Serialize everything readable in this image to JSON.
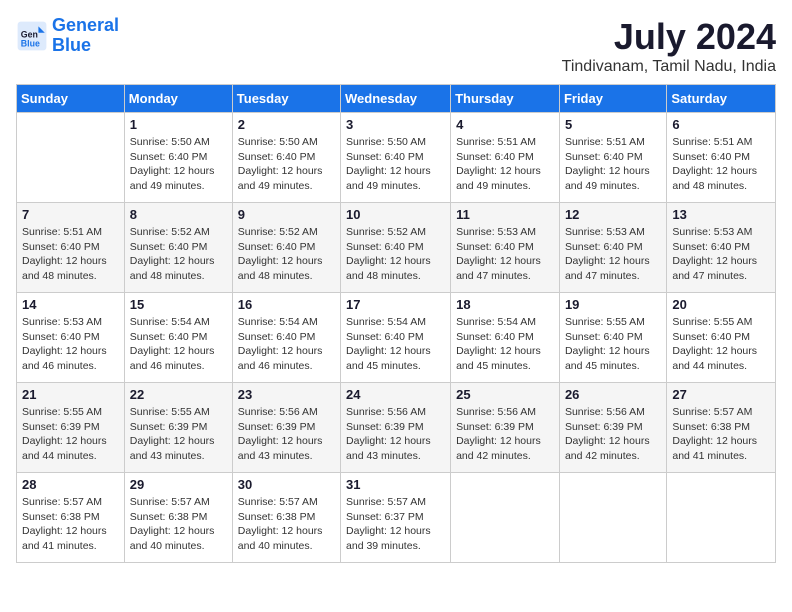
{
  "logo": {
    "line1": "General",
    "line2": "Blue"
  },
  "title": "July 2024",
  "location": "Tindivanam, Tamil Nadu, India",
  "weekdays": [
    "Sunday",
    "Monday",
    "Tuesday",
    "Wednesday",
    "Thursday",
    "Friday",
    "Saturday"
  ],
  "weeks": [
    [
      {
        "day": "",
        "info": ""
      },
      {
        "day": "1",
        "info": "Sunrise: 5:50 AM\nSunset: 6:40 PM\nDaylight: 12 hours\nand 49 minutes."
      },
      {
        "day": "2",
        "info": "Sunrise: 5:50 AM\nSunset: 6:40 PM\nDaylight: 12 hours\nand 49 minutes."
      },
      {
        "day": "3",
        "info": "Sunrise: 5:50 AM\nSunset: 6:40 PM\nDaylight: 12 hours\nand 49 minutes."
      },
      {
        "day": "4",
        "info": "Sunrise: 5:51 AM\nSunset: 6:40 PM\nDaylight: 12 hours\nand 49 minutes."
      },
      {
        "day": "5",
        "info": "Sunrise: 5:51 AM\nSunset: 6:40 PM\nDaylight: 12 hours\nand 49 minutes."
      },
      {
        "day": "6",
        "info": "Sunrise: 5:51 AM\nSunset: 6:40 PM\nDaylight: 12 hours\nand 48 minutes."
      }
    ],
    [
      {
        "day": "7",
        "info": "Sunrise: 5:51 AM\nSunset: 6:40 PM\nDaylight: 12 hours\nand 48 minutes."
      },
      {
        "day": "8",
        "info": "Sunrise: 5:52 AM\nSunset: 6:40 PM\nDaylight: 12 hours\nand 48 minutes."
      },
      {
        "day": "9",
        "info": "Sunrise: 5:52 AM\nSunset: 6:40 PM\nDaylight: 12 hours\nand 48 minutes."
      },
      {
        "day": "10",
        "info": "Sunrise: 5:52 AM\nSunset: 6:40 PM\nDaylight: 12 hours\nand 48 minutes."
      },
      {
        "day": "11",
        "info": "Sunrise: 5:53 AM\nSunset: 6:40 PM\nDaylight: 12 hours\nand 47 minutes."
      },
      {
        "day": "12",
        "info": "Sunrise: 5:53 AM\nSunset: 6:40 PM\nDaylight: 12 hours\nand 47 minutes."
      },
      {
        "day": "13",
        "info": "Sunrise: 5:53 AM\nSunset: 6:40 PM\nDaylight: 12 hours\nand 47 minutes."
      }
    ],
    [
      {
        "day": "14",
        "info": "Sunrise: 5:53 AM\nSunset: 6:40 PM\nDaylight: 12 hours\nand 46 minutes."
      },
      {
        "day": "15",
        "info": "Sunrise: 5:54 AM\nSunset: 6:40 PM\nDaylight: 12 hours\nand 46 minutes."
      },
      {
        "day": "16",
        "info": "Sunrise: 5:54 AM\nSunset: 6:40 PM\nDaylight: 12 hours\nand 46 minutes."
      },
      {
        "day": "17",
        "info": "Sunrise: 5:54 AM\nSunset: 6:40 PM\nDaylight: 12 hours\nand 45 minutes."
      },
      {
        "day": "18",
        "info": "Sunrise: 5:54 AM\nSunset: 6:40 PM\nDaylight: 12 hours\nand 45 minutes."
      },
      {
        "day": "19",
        "info": "Sunrise: 5:55 AM\nSunset: 6:40 PM\nDaylight: 12 hours\nand 45 minutes."
      },
      {
        "day": "20",
        "info": "Sunrise: 5:55 AM\nSunset: 6:40 PM\nDaylight: 12 hours\nand 44 minutes."
      }
    ],
    [
      {
        "day": "21",
        "info": "Sunrise: 5:55 AM\nSunset: 6:39 PM\nDaylight: 12 hours\nand 44 minutes."
      },
      {
        "day": "22",
        "info": "Sunrise: 5:55 AM\nSunset: 6:39 PM\nDaylight: 12 hours\nand 43 minutes."
      },
      {
        "day": "23",
        "info": "Sunrise: 5:56 AM\nSunset: 6:39 PM\nDaylight: 12 hours\nand 43 minutes."
      },
      {
        "day": "24",
        "info": "Sunrise: 5:56 AM\nSunset: 6:39 PM\nDaylight: 12 hours\nand 43 minutes."
      },
      {
        "day": "25",
        "info": "Sunrise: 5:56 AM\nSunset: 6:39 PM\nDaylight: 12 hours\nand 42 minutes."
      },
      {
        "day": "26",
        "info": "Sunrise: 5:56 AM\nSunset: 6:39 PM\nDaylight: 12 hours\nand 42 minutes."
      },
      {
        "day": "27",
        "info": "Sunrise: 5:57 AM\nSunset: 6:38 PM\nDaylight: 12 hours\nand 41 minutes."
      }
    ],
    [
      {
        "day": "28",
        "info": "Sunrise: 5:57 AM\nSunset: 6:38 PM\nDaylight: 12 hours\nand 41 minutes."
      },
      {
        "day": "29",
        "info": "Sunrise: 5:57 AM\nSunset: 6:38 PM\nDaylight: 12 hours\nand 40 minutes."
      },
      {
        "day": "30",
        "info": "Sunrise: 5:57 AM\nSunset: 6:38 PM\nDaylight: 12 hours\nand 40 minutes."
      },
      {
        "day": "31",
        "info": "Sunrise: 5:57 AM\nSunset: 6:37 PM\nDaylight: 12 hours\nand 39 minutes."
      },
      {
        "day": "",
        "info": ""
      },
      {
        "day": "",
        "info": ""
      },
      {
        "day": "",
        "info": ""
      }
    ]
  ]
}
